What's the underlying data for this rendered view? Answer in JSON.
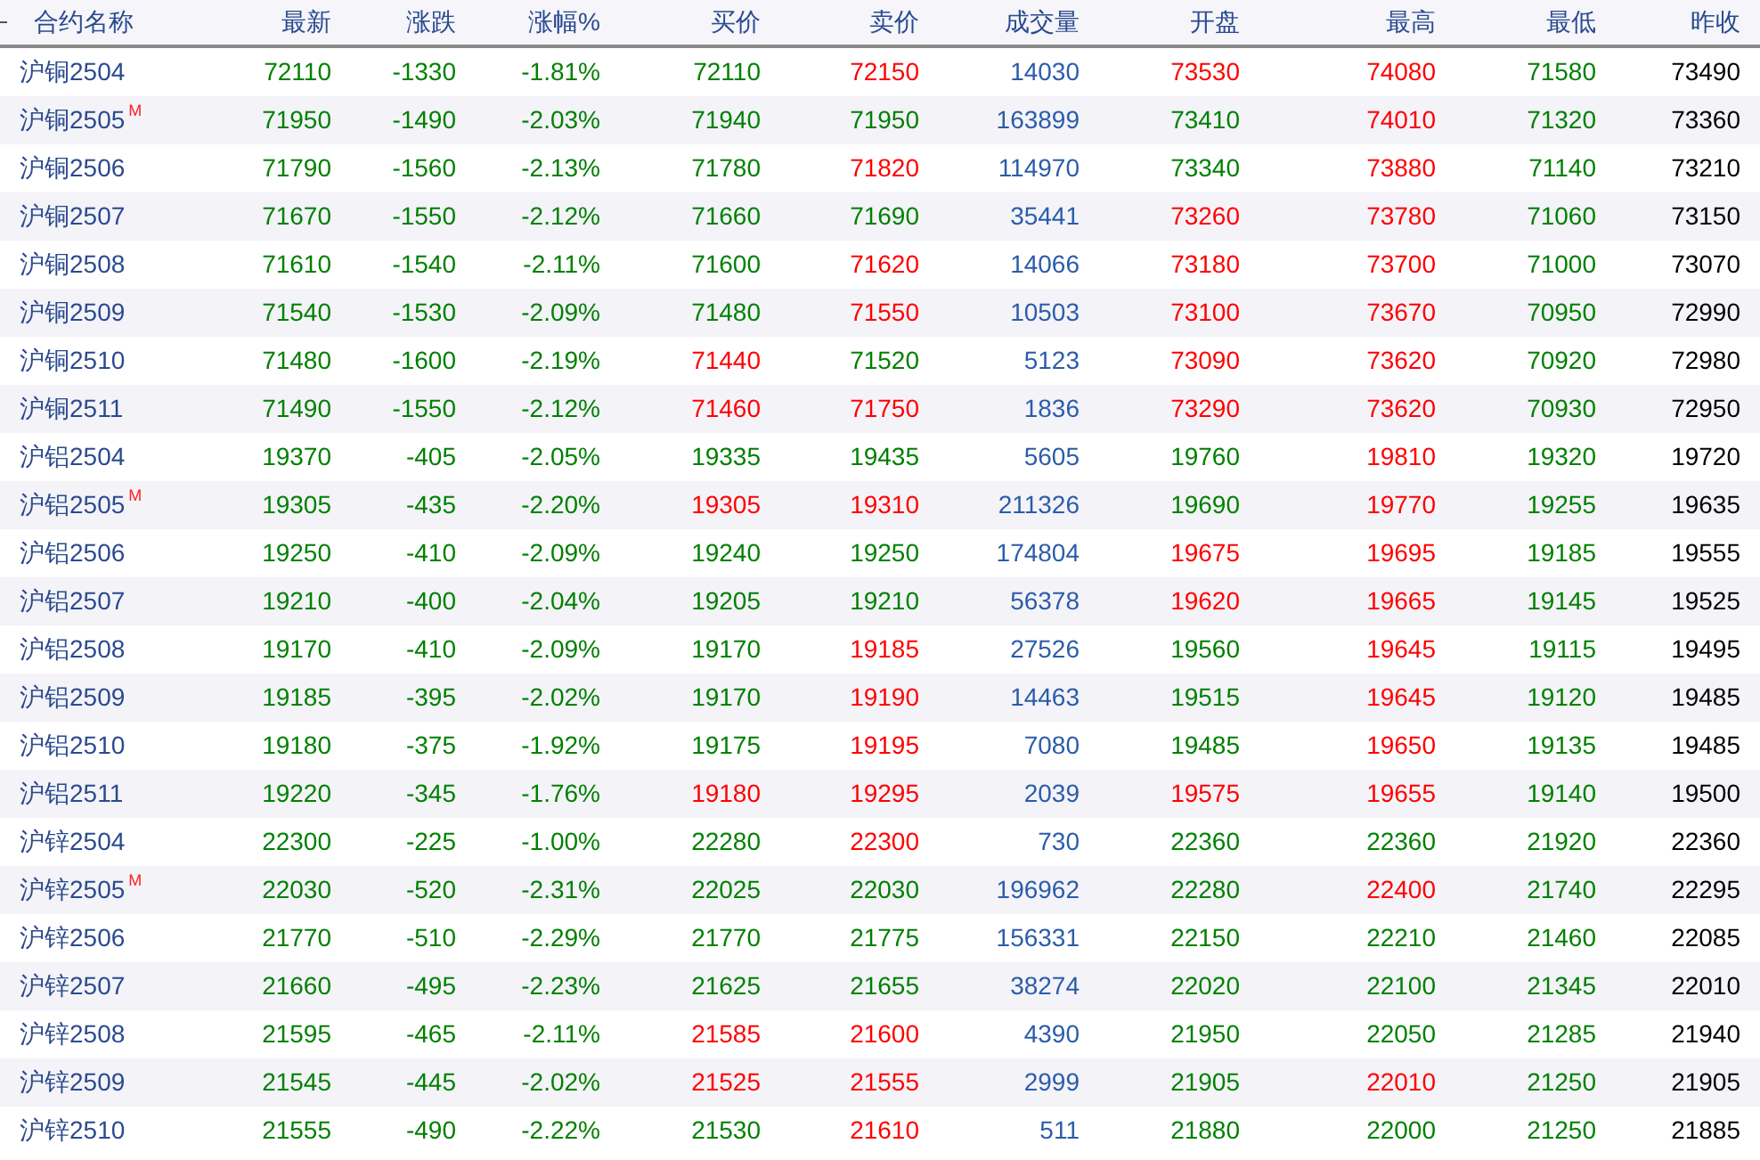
{
  "columns": [
    "合约名称",
    "最新",
    "涨跌",
    "涨幅%",
    "买价",
    "卖价",
    "成交量",
    "开盘",
    "最高",
    "最低",
    "昨收"
  ],
  "rows": [
    {
      "name": "沪铜2504",
      "cells": [
        {
          "text": "72110",
          "color": "#008000"
        },
        {
          "text": "-1330",
          "color": "#008000"
        },
        {
          "text": "-1.81%",
          "color": "#008000"
        },
        {
          "text": "72110",
          "color": "#008000"
        },
        {
          "text": "72150",
          "color": "#ff0000"
        },
        {
          "text": "14030",
          "color": "#2a5caa"
        },
        {
          "text": "73530",
          "color": "#ff0000"
        },
        {
          "text": "74080",
          "color": "#ff0000"
        },
        {
          "text": "71580",
          "color": "#008000"
        },
        {
          "text": "73490",
          "color": "#000000"
        }
      ]
    },
    {
      "name": "沪铜2505",
      "badge": "M",
      "cells": [
        {
          "text": "71950",
          "color": "#008000"
        },
        {
          "text": "-1490",
          "color": "#008000"
        },
        {
          "text": "-2.03%",
          "color": "#008000"
        },
        {
          "text": "71940",
          "color": "#008000"
        },
        {
          "text": "71950",
          "color": "#008000"
        },
        {
          "text": "163899",
          "color": "#2a5caa"
        },
        {
          "text": "73410",
          "color": "#008000"
        },
        {
          "text": "74010",
          "color": "#ff0000"
        },
        {
          "text": "71320",
          "color": "#008000"
        },
        {
          "text": "73360",
          "color": "#000000"
        }
      ]
    },
    {
      "name": "沪铜2506",
      "cells": [
        {
          "text": "71790",
          "color": "#008000"
        },
        {
          "text": "-1560",
          "color": "#008000"
        },
        {
          "text": "-2.13%",
          "color": "#008000"
        },
        {
          "text": "71780",
          "color": "#008000"
        },
        {
          "text": "71820",
          "color": "#ff0000"
        },
        {
          "text": "114970",
          "color": "#2a5caa"
        },
        {
          "text": "73340",
          "color": "#008000"
        },
        {
          "text": "73880",
          "color": "#ff0000"
        },
        {
          "text": "71140",
          "color": "#008000"
        },
        {
          "text": "73210",
          "color": "#000000"
        }
      ]
    },
    {
      "name": "沪铜2507",
      "cells": [
        {
          "text": "71670",
          "color": "#008000"
        },
        {
          "text": "-1550",
          "color": "#008000"
        },
        {
          "text": "-2.12%",
          "color": "#008000"
        },
        {
          "text": "71660",
          "color": "#008000"
        },
        {
          "text": "71690",
          "color": "#008000"
        },
        {
          "text": "35441",
          "color": "#2a5caa"
        },
        {
          "text": "73260",
          "color": "#ff0000"
        },
        {
          "text": "73780",
          "color": "#ff0000"
        },
        {
          "text": "71060",
          "color": "#008000"
        },
        {
          "text": "73150",
          "color": "#000000"
        }
      ]
    },
    {
      "name": "沪铜2508",
      "cells": [
        {
          "text": "71610",
          "color": "#008000"
        },
        {
          "text": "-1540",
          "color": "#008000"
        },
        {
          "text": "-2.11%",
          "color": "#008000"
        },
        {
          "text": "71600",
          "color": "#008000"
        },
        {
          "text": "71620",
          "color": "#ff0000"
        },
        {
          "text": "14066",
          "color": "#2a5caa"
        },
        {
          "text": "73180",
          "color": "#ff0000"
        },
        {
          "text": "73700",
          "color": "#ff0000"
        },
        {
          "text": "71000",
          "color": "#008000"
        },
        {
          "text": "73070",
          "color": "#000000"
        }
      ]
    },
    {
      "name": "沪铜2509",
      "cells": [
        {
          "text": "71540",
          "color": "#008000"
        },
        {
          "text": "-1530",
          "color": "#008000"
        },
        {
          "text": "-2.09%",
          "color": "#008000"
        },
        {
          "text": "71480",
          "color": "#008000"
        },
        {
          "text": "71550",
          "color": "#ff0000"
        },
        {
          "text": "10503",
          "color": "#2a5caa"
        },
        {
          "text": "73100",
          "color": "#ff0000"
        },
        {
          "text": "73670",
          "color": "#ff0000"
        },
        {
          "text": "70950",
          "color": "#008000"
        },
        {
          "text": "72990",
          "color": "#000000"
        }
      ]
    },
    {
      "name": "沪铜2510",
      "cells": [
        {
          "text": "71480",
          "color": "#008000"
        },
        {
          "text": "-1600",
          "color": "#008000"
        },
        {
          "text": "-2.19%",
          "color": "#008000"
        },
        {
          "text": "71440",
          "color": "#ff0000"
        },
        {
          "text": "71520",
          "color": "#008000"
        },
        {
          "text": "5123",
          "color": "#2a5caa"
        },
        {
          "text": "73090",
          "color": "#ff0000"
        },
        {
          "text": "73620",
          "color": "#ff0000"
        },
        {
          "text": "70920",
          "color": "#008000"
        },
        {
          "text": "72980",
          "color": "#000000"
        }
      ]
    },
    {
      "name": "沪铜2511",
      "cells": [
        {
          "text": "71490",
          "color": "#008000"
        },
        {
          "text": "-1550",
          "color": "#008000"
        },
        {
          "text": "-2.12%",
          "color": "#008000"
        },
        {
          "text": "71460",
          "color": "#ff0000"
        },
        {
          "text": "71750",
          "color": "#ff0000"
        },
        {
          "text": "1836",
          "color": "#2a5caa"
        },
        {
          "text": "73290",
          "color": "#ff0000"
        },
        {
          "text": "73620",
          "color": "#ff0000"
        },
        {
          "text": "70930",
          "color": "#008000"
        },
        {
          "text": "72950",
          "color": "#000000"
        }
      ]
    },
    {
      "name": "沪铝2504",
      "cells": [
        {
          "text": "19370",
          "color": "#008000"
        },
        {
          "text": "-405",
          "color": "#008000"
        },
        {
          "text": "-2.05%",
          "color": "#008000"
        },
        {
          "text": "19335",
          "color": "#008000"
        },
        {
          "text": "19435",
          "color": "#008000"
        },
        {
          "text": "5605",
          "color": "#2a5caa"
        },
        {
          "text": "19760",
          "color": "#008000"
        },
        {
          "text": "19810",
          "color": "#ff0000"
        },
        {
          "text": "19320",
          "color": "#008000"
        },
        {
          "text": "19720",
          "color": "#000000"
        }
      ]
    },
    {
      "name": "沪铝2505",
      "badge": "M",
      "cells": [
        {
          "text": "19305",
          "color": "#008000"
        },
        {
          "text": "-435",
          "color": "#008000"
        },
        {
          "text": "-2.20%",
          "color": "#008000"
        },
        {
          "text": "19305",
          "color": "#ff0000"
        },
        {
          "text": "19310",
          "color": "#ff0000"
        },
        {
          "text": "211326",
          "color": "#2a5caa"
        },
        {
          "text": "19690",
          "color": "#008000"
        },
        {
          "text": "19770",
          "color": "#ff0000"
        },
        {
          "text": "19255",
          "color": "#008000"
        },
        {
          "text": "19635",
          "color": "#000000"
        }
      ]
    },
    {
      "name": "沪铝2506",
      "cells": [
        {
          "text": "19250",
          "color": "#008000"
        },
        {
          "text": "-410",
          "color": "#008000"
        },
        {
          "text": "-2.09%",
          "color": "#008000"
        },
        {
          "text": "19240",
          "color": "#008000"
        },
        {
          "text": "19250",
          "color": "#008000"
        },
        {
          "text": "174804",
          "color": "#2a5caa"
        },
        {
          "text": "19675",
          "color": "#ff0000"
        },
        {
          "text": "19695",
          "color": "#ff0000"
        },
        {
          "text": "19185",
          "color": "#008000"
        },
        {
          "text": "19555",
          "color": "#000000"
        }
      ]
    },
    {
      "name": "沪铝2507",
      "cells": [
        {
          "text": "19210",
          "color": "#008000"
        },
        {
          "text": "-400",
          "color": "#008000"
        },
        {
          "text": "-2.04%",
          "color": "#008000"
        },
        {
          "text": "19205",
          "color": "#008000"
        },
        {
          "text": "19210",
          "color": "#008000"
        },
        {
          "text": "56378",
          "color": "#2a5caa"
        },
        {
          "text": "19620",
          "color": "#ff0000"
        },
        {
          "text": "19665",
          "color": "#ff0000"
        },
        {
          "text": "19145",
          "color": "#008000"
        },
        {
          "text": "19525",
          "color": "#000000"
        }
      ]
    },
    {
      "name": "沪铝2508",
      "cells": [
        {
          "text": "19170",
          "color": "#008000"
        },
        {
          "text": "-410",
          "color": "#008000"
        },
        {
          "text": "-2.09%",
          "color": "#008000"
        },
        {
          "text": "19170",
          "color": "#008000"
        },
        {
          "text": "19185",
          "color": "#ff0000"
        },
        {
          "text": "27526",
          "color": "#2a5caa"
        },
        {
          "text": "19560",
          "color": "#008000"
        },
        {
          "text": "19645",
          "color": "#ff0000"
        },
        {
          "text": "19115",
          "color": "#008000"
        },
        {
          "text": "19495",
          "color": "#000000"
        }
      ]
    },
    {
      "name": "沪铝2509",
      "cells": [
        {
          "text": "19185",
          "color": "#008000"
        },
        {
          "text": "-395",
          "color": "#008000"
        },
        {
          "text": "-2.02%",
          "color": "#008000"
        },
        {
          "text": "19170",
          "color": "#008000"
        },
        {
          "text": "19190",
          "color": "#ff0000"
        },
        {
          "text": "14463",
          "color": "#2a5caa"
        },
        {
          "text": "19515",
          "color": "#008000"
        },
        {
          "text": "19645",
          "color": "#ff0000"
        },
        {
          "text": "19120",
          "color": "#008000"
        },
        {
          "text": "19485",
          "color": "#000000"
        }
      ]
    },
    {
      "name": "沪铝2510",
      "cells": [
        {
          "text": "19180",
          "color": "#008000"
        },
        {
          "text": "-375",
          "color": "#008000"
        },
        {
          "text": "-1.92%",
          "color": "#008000"
        },
        {
          "text": "19175",
          "color": "#008000"
        },
        {
          "text": "19195",
          "color": "#ff0000"
        },
        {
          "text": "7080",
          "color": "#2a5caa"
        },
        {
          "text": "19485",
          "color": "#008000"
        },
        {
          "text": "19650",
          "color": "#ff0000"
        },
        {
          "text": "19135",
          "color": "#008000"
        },
        {
          "text": "19485",
          "color": "#000000"
        }
      ]
    },
    {
      "name": "沪铝2511",
      "cells": [
        {
          "text": "19220",
          "color": "#008000"
        },
        {
          "text": "-345",
          "color": "#008000"
        },
        {
          "text": "-1.76%",
          "color": "#008000"
        },
        {
          "text": "19180",
          "color": "#ff0000"
        },
        {
          "text": "19295",
          "color": "#ff0000"
        },
        {
          "text": "2039",
          "color": "#2a5caa"
        },
        {
          "text": "19575",
          "color": "#ff0000"
        },
        {
          "text": "19655",
          "color": "#ff0000"
        },
        {
          "text": "19140",
          "color": "#008000"
        },
        {
          "text": "19500",
          "color": "#000000"
        }
      ]
    },
    {
      "name": "沪锌2504",
      "cells": [
        {
          "text": "22300",
          "color": "#008000"
        },
        {
          "text": "-225",
          "color": "#008000"
        },
        {
          "text": "-1.00%",
          "color": "#008000"
        },
        {
          "text": "22280",
          "color": "#008000"
        },
        {
          "text": "22300",
          "color": "#ff0000"
        },
        {
          "text": "730",
          "color": "#2a5caa"
        },
        {
          "text": "22360",
          "color": "#008000"
        },
        {
          "text": "22360",
          "color": "#008000"
        },
        {
          "text": "21920",
          "color": "#008000"
        },
        {
          "text": "22360",
          "color": "#000000"
        }
      ]
    },
    {
      "name": "沪锌2505",
      "badge": "M",
      "cells": [
        {
          "text": "22030",
          "color": "#008000"
        },
        {
          "text": "-520",
          "color": "#008000"
        },
        {
          "text": "-2.31%",
          "color": "#008000"
        },
        {
          "text": "22025",
          "color": "#008000"
        },
        {
          "text": "22030",
          "color": "#008000"
        },
        {
          "text": "196962",
          "color": "#2a5caa"
        },
        {
          "text": "22280",
          "color": "#008000"
        },
        {
          "text": "22400",
          "color": "#ff0000"
        },
        {
          "text": "21740",
          "color": "#008000"
        },
        {
          "text": "22295",
          "color": "#000000"
        }
      ]
    },
    {
      "name": "沪锌2506",
      "cells": [
        {
          "text": "21770",
          "color": "#008000"
        },
        {
          "text": "-510",
          "color": "#008000"
        },
        {
          "text": "-2.29%",
          "color": "#008000"
        },
        {
          "text": "21770",
          "color": "#008000"
        },
        {
          "text": "21775",
          "color": "#008000"
        },
        {
          "text": "156331",
          "color": "#2a5caa"
        },
        {
          "text": "22150",
          "color": "#008000"
        },
        {
          "text": "22210",
          "color": "#008000"
        },
        {
          "text": "21460",
          "color": "#008000"
        },
        {
          "text": "22085",
          "color": "#000000"
        }
      ]
    },
    {
      "name": "沪锌2507",
      "cells": [
        {
          "text": "21660",
          "color": "#008000"
        },
        {
          "text": "-495",
          "color": "#008000"
        },
        {
          "text": "-2.23%",
          "color": "#008000"
        },
        {
          "text": "21625",
          "color": "#008000"
        },
        {
          "text": "21655",
          "color": "#008000"
        },
        {
          "text": "38274",
          "color": "#2a5caa"
        },
        {
          "text": "22020",
          "color": "#008000"
        },
        {
          "text": "22100",
          "color": "#008000"
        },
        {
          "text": "21345",
          "color": "#008000"
        },
        {
          "text": "22010",
          "color": "#000000"
        }
      ]
    },
    {
      "name": "沪锌2508",
      "cells": [
        {
          "text": "21595",
          "color": "#008000"
        },
        {
          "text": "-465",
          "color": "#008000"
        },
        {
          "text": "-2.11%",
          "color": "#008000"
        },
        {
          "text": "21585",
          "color": "#ff0000"
        },
        {
          "text": "21600",
          "color": "#ff0000"
        },
        {
          "text": "4390",
          "color": "#2a5caa"
        },
        {
          "text": "21950",
          "color": "#008000"
        },
        {
          "text": "22050",
          "color": "#008000"
        },
        {
          "text": "21285",
          "color": "#008000"
        },
        {
          "text": "21940",
          "color": "#000000"
        }
      ]
    },
    {
      "name": "沪锌2509",
      "cells": [
        {
          "text": "21545",
          "color": "#008000"
        },
        {
          "text": "-445",
          "color": "#008000"
        },
        {
          "text": "-2.02%",
          "color": "#008000"
        },
        {
          "text": "21525",
          "color": "#ff0000"
        },
        {
          "text": "21555",
          "color": "#ff0000"
        },
        {
          "text": "2999",
          "color": "#2a5caa"
        },
        {
          "text": "21905",
          "color": "#008000"
        },
        {
          "text": "22010",
          "color": "#ff0000"
        },
        {
          "text": "21250",
          "color": "#008000"
        },
        {
          "text": "21905",
          "color": "#000000"
        }
      ]
    },
    {
      "name": "沪锌2510",
      "cells": [
        {
          "text": "21555",
          "color": "#008000"
        },
        {
          "text": "-490",
          "color": "#008000"
        },
        {
          "text": "-2.22%",
          "color": "#008000"
        },
        {
          "text": "21530",
          "color": "#008000"
        },
        {
          "text": "21610",
          "color": "#ff0000"
        },
        {
          "text": "511",
          "color": "#2a5caa"
        },
        {
          "text": "21880",
          "color": "#008000"
        },
        {
          "text": "22000",
          "color": "#008000"
        },
        {
          "text": "21250",
          "color": "#008000"
        },
        {
          "text": "21885",
          "color": "#000000"
        }
      ]
    }
  ]
}
